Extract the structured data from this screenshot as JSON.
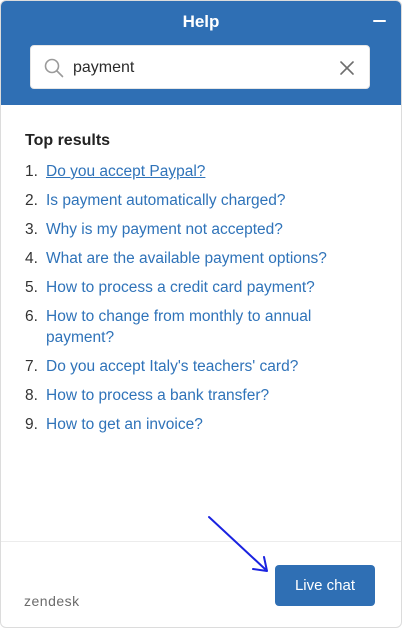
{
  "header": {
    "title": "Help"
  },
  "search": {
    "value": "payment",
    "placeholder": ""
  },
  "results": {
    "heading": "Top results",
    "items": [
      {
        "num": "1.",
        "label": "Do you accept Paypal?"
      },
      {
        "num": "2.",
        "label": "Is payment automatically charged?"
      },
      {
        "num": "3.",
        "label": "Why is my payment not accepted?"
      },
      {
        "num": "4.",
        "label": "What are the available payment options?"
      },
      {
        "num": "5.",
        "label": "How to process a credit card payment?"
      },
      {
        "num": "6.",
        "label": "How to change from monthly to annual payment?"
      },
      {
        "num": "7.",
        "label": "Do you accept Italy's teachers' card?"
      },
      {
        "num": "8.",
        "label": "How to process a bank transfer?"
      },
      {
        "num": "9.",
        "label": "How to get an invoice?"
      }
    ]
  },
  "footer": {
    "logo": "zendesk",
    "live_chat_label": "Live chat"
  },
  "colors": {
    "brand": "#2f6fb4",
    "link": "#2f73b9",
    "annotation_arrow": "#1a23e0"
  },
  "icons": {
    "search": "search-icon",
    "clear": "close-icon",
    "minimize": "minimize-icon"
  }
}
